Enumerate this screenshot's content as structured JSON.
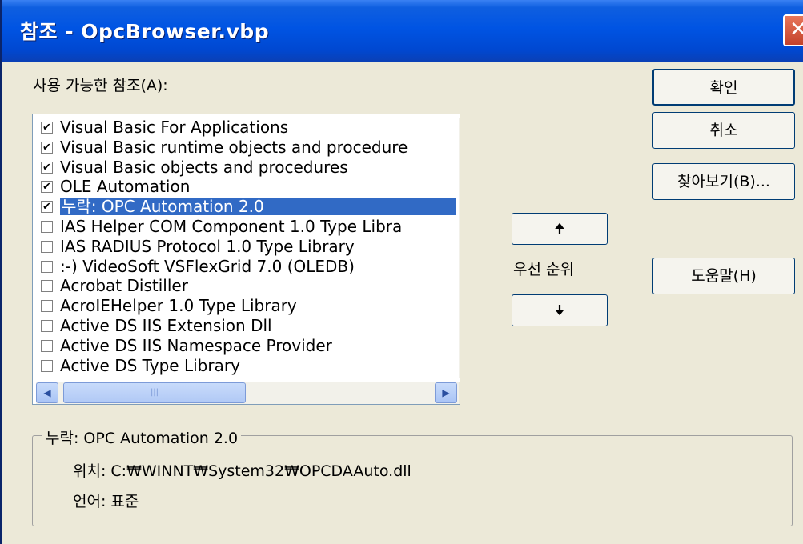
{
  "window": {
    "title": "참조 - OpcBrowser.vbp",
    "close_glyph": "✕"
  },
  "available_label": "사용 가능한 참조(A):",
  "references": [
    {
      "label": "Visual Basic For Applications",
      "checked": true
    },
    {
      "label": "Visual Basic runtime objects and procedure",
      "checked": true
    },
    {
      "label": "Visual Basic objects and procedures",
      "checked": true
    },
    {
      "label": "OLE Automation",
      "checked": true
    },
    {
      "label": "누락: OPC Automation 2.0",
      "checked": true,
      "selected": true
    },
    {
      "label": "IAS Helper COM Component 1.0 Type Libra",
      "checked": false
    },
    {
      "label": "IAS RADIUS Protocol 1.0 Type Library",
      "checked": false
    },
    {
      "label": ":-) VideoSoft VSFlexGrid 7.0 (OLEDB)",
      "checked": false
    },
    {
      "label": "Acrobat Distiller",
      "checked": false
    },
    {
      "label": "AcroIEHelper 1.0 Type Library",
      "checked": false
    },
    {
      "label": "Active DS IIS Extension Dll",
      "checked": false
    },
    {
      "label": "Active DS IIS Namespace Provider",
      "checked": false
    },
    {
      "label": "Active DS Type Library",
      "checked": false
    },
    {
      "label": "Active Setup Control Library",
      "checked": false
    }
  ],
  "buttons": {
    "ok": "확인",
    "cancel": "취소",
    "browse": "찾아보기(B)...",
    "help": "도움말(H)",
    "up_glyph": "🠉",
    "down_glyph": "🠋"
  },
  "priority_label": "우선 순위",
  "details": {
    "group_title": "누락: OPC Automation 2.0",
    "location": "위치:  C:₩WINNT₩System32₩OPCDAAuto.dll",
    "language": "언어:  표준"
  },
  "icons": {
    "scroll_up": "▲",
    "scroll_down": "▼",
    "scroll_left": "◀",
    "scroll_right": "▶",
    "check": "✔"
  },
  "colors": {
    "titlebar": "#0054e3",
    "selection": "#316ac5",
    "dialog_bg": "#ece9d8",
    "close_button": "#d4543a"
  }
}
